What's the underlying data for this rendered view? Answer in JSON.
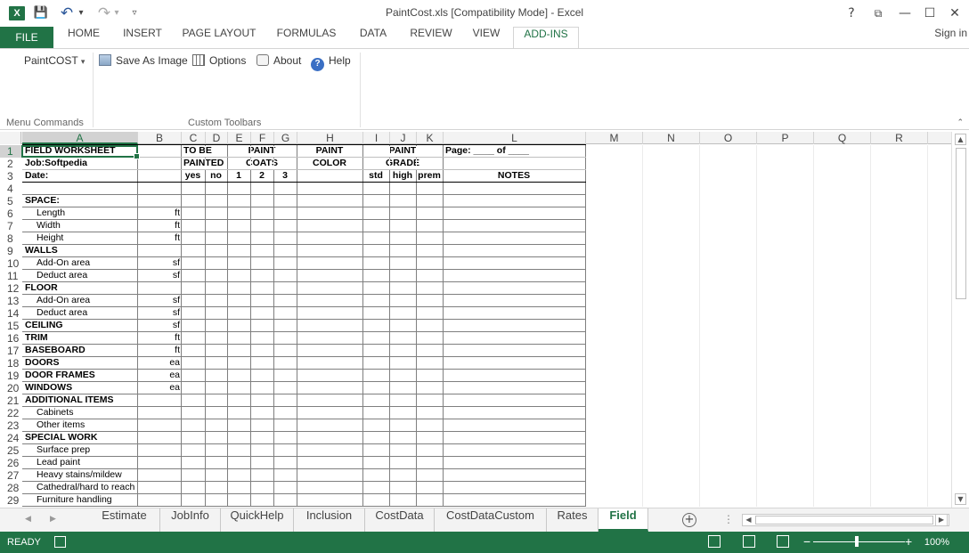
{
  "window": {
    "app_icon": "X",
    "title": "PaintCost.xls  [Compatibility Mode] - Excel",
    "help": "?",
    "minimize": "—",
    "maximize": "☐",
    "close": "✕",
    "ribbon_display": "⧉"
  },
  "quick_access": {
    "save": "💾",
    "undo": "↶",
    "undo_menu": "▾",
    "redo": "↷",
    "redo_menu": "▾",
    "customize": "▿"
  },
  "tabs": {
    "file": "FILE",
    "items": [
      "HOME",
      "INSERT",
      "PAGE LAYOUT",
      "FORMULAS",
      "DATA",
      "REVIEW",
      "VIEW",
      "ADD-INS"
    ],
    "active": "ADD-INS",
    "sign_in": "Sign in"
  },
  "ribbon": {
    "menu_commands": {
      "paintcost": "PaintCOST",
      "dropdown": "▾",
      "group_label": "Menu Commands"
    },
    "custom_toolbars": {
      "save_as_image": "Save As Image",
      "options": "Options",
      "about": "About",
      "help": "Help",
      "help_icon_glyph": "?",
      "group_label": "Custom Toolbars"
    },
    "collapse": "⌃"
  },
  "grid": {
    "columns": [
      "A",
      "B",
      "C",
      "D",
      "E",
      "F",
      "G",
      "H",
      "I",
      "J",
      "K",
      "L",
      "M",
      "N",
      "O",
      "P",
      "Q",
      "R"
    ],
    "selected_column": "A",
    "selected_row": 1,
    "rows": [
      1,
      2,
      3,
      4,
      5,
      6,
      7,
      8,
      9,
      10,
      11,
      12,
      13,
      14,
      15,
      16,
      17,
      18,
      19,
      20,
      21,
      22,
      23,
      24,
      25,
      26,
      27,
      28,
      29
    ],
    "header": {
      "r1": {
        "a": "FIELD WORKSHEET",
        "cd": "TO BE",
        "eg": "PAINT",
        "h": "PAINT",
        "ik": "PAINT",
        "l": "Page: ____ of ____"
      },
      "r2": {
        "a": "Job:Softpedia",
        "cd": "PAINTED",
        "eg": "COATS",
        "h": "COLOR",
        "ik": "GRADE"
      },
      "r3": {
        "a": "Date:",
        "c": "yes",
        "d": "no",
        "e": "1",
        "f": "2",
        "g": "3",
        "i": "std",
        "j": "high",
        "k": "prem",
        "l": "NOTES"
      }
    },
    "items": [
      {
        "row": 5,
        "label": "SPACE:",
        "bold": true,
        "unit": ""
      },
      {
        "row": 6,
        "label": "Length",
        "bold": false,
        "unit": "ft"
      },
      {
        "row": 7,
        "label": "Width",
        "bold": false,
        "unit": "ft"
      },
      {
        "row": 8,
        "label": "Height",
        "bold": false,
        "unit": "ft"
      },
      {
        "row": 9,
        "label": "WALLS",
        "bold": true,
        "unit": ""
      },
      {
        "row": 10,
        "label": "Add-On area",
        "bold": false,
        "unit": "sf"
      },
      {
        "row": 11,
        "label": "Deduct area",
        "bold": false,
        "unit": "sf"
      },
      {
        "row": 12,
        "label": "FLOOR",
        "bold": true,
        "unit": ""
      },
      {
        "row": 13,
        "label": "Add-On area",
        "bold": false,
        "unit": "sf"
      },
      {
        "row": 14,
        "label": "Deduct area",
        "bold": false,
        "unit": "sf"
      },
      {
        "row": 15,
        "label": "CEILING",
        "bold": true,
        "unit": "sf"
      },
      {
        "row": 16,
        "label": "TRIM",
        "bold": true,
        "unit": "ft"
      },
      {
        "row": 17,
        "label": "BASEBOARD",
        "bold": true,
        "unit": "ft"
      },
      {
        "row": 18,
        "label": "DOORS",
        "bold": true,
        "unit": "ea"
      },
      {
        "row": 19,
        "label": "DOOR FRAMES",
        "bold": true,
        "unit": "ea"
      },
      {
        "row": 20,
        "label": "WINDOWS",
        "bold": true,
        "unit": "ea"
      },
      {
        "row": 21,
        "label": "ADDITIONAL ITEMS",
        "bold": true,
        "unit": ""
      },
      {
        "row": 22,
        "label": "Cabinets",
        "bold": false,
        "unit": ""
      },
      {
        "row": 23,
        "label": "Other items",
        "bold": false,
        "unit": ""
      },
      {
        "row": 24,
        "label": "SPECIAL WORK",
        "bold": true,
        "unit": ""
      },
      {
        "row": 25,
        "label": "Surface prep",
        "bold": false,
        "unit": ""
      },
      {
        "row": 26,
        "label": "Lead paint",
        "bold": false,
        "unit": ""
      },
      {
        "row": 27,
        "label": "Heavy stains/mildew",
        "bold": false,
        "unit": ""
      },
      {
        "row": 28,
        "label": "Cathedral/hard to reach",
        "bold": false,
        "unit": ""
      },
      {
        "row": 29,
        "label": "Furniture handling",
        "bold": false,
        "unit": ""
      }
    ]
  },
  "scroll": {
    "up": "▲",
    "down": "▼",
    "left": "◀",
    "right": "▶"
  },
  "sheets": {
    "nav_prev": "◀",
    "nav_next": "▶",
    "tabs": [
      "Estimate",
      "JobInfo",
      "QuickHelp",
      "Inclusion",
      "CostData",
      "CostDataCustom",
      "Rates",
      "Field"
    ],
    "active": "Field",
    "add": "+",
    "more": "⋮"
  },
  "status": {
    "ready": "READY",
    "zoom_minus": "−",
    "zoom_plus": "+",
    "zoom": "100%",
    "zoom_level_percent": 100
  },
  "colors": {
    "excel_green": "#217346",
    "accent_blue": "#3a6fc4"
  }
}
